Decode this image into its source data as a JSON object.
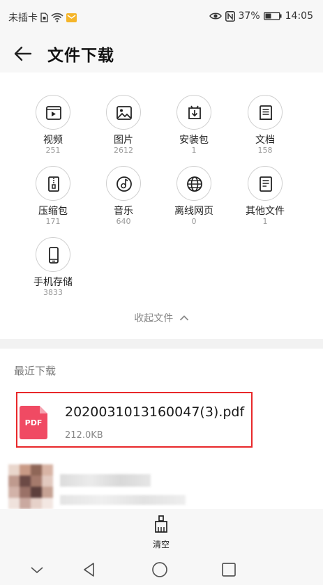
{
  "status_bar": {
    "carrier": "未插卡",
    "battery_percent": "37%",
    "time": "14:05"
  },
  "header": {
    "title": "文件下载"
  },
  "categories": [
    {
      "label": "视频",
      "count": "251",
      "icon": "video-icon"
    },
    {
      "label": "图片",
      "count": "2612",
      "icon": "image-icon"
    },
    {
      "label": "安装包",
      "count": "1",
      "icon": "package-icon"
    },
    {
      "label": "文档",
      "count": "158",
      "icon": "document-icon"
    },
    {
      "label": "压缩包",
      "count": "171",
      "icon": "zip-icon"
    },
    {
      "label": "音乐",
      "count": "640",
      "icon": "music-icon"
    },
    {
      "label": "离线网页",
      "count": "0",
      "icon": "globe-icon"
    },
    {
      "label": "其他文件",
      "count": "1",
      "icon": "other-file-icon"
    },
    {
      "label": "手机存储",
      "count": "3833",
      "icon": "phone-icon"
    }
  ],
  "collapse_label": "收起文件",
  "recent": {
    "title": "最近下载",
    "files": [
      {
        "name": "2020031013160047(3).pdf",
        "size": "212.0KB",
        "type_label": "PDF"
      }
    ]
  },
  "bottom": {
    "clear_label": "清空"
  },
  "colors": {
    "highlight": "#e8282a",
    "pdf": "#f04a63"
  }
}
